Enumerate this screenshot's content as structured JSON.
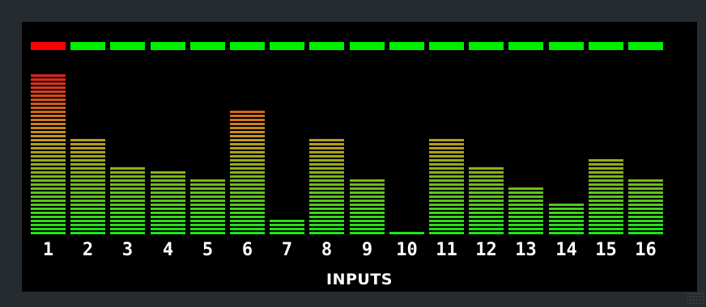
{
  "meter": {
    "title": "INPUTS",
    "max_level": 1.0,
    "channels": [
      {
        "label": "1",
        "level": 1.0,
        "clip": true
      },
      {
        "label": "2",
        "level": 0.61,
        "clip": false
      },
      {
        "label": "3",
        "level": 0.42,
        "clip": false
      },
      {
        "label": "4",
        "level": 0.39,
        "clip": false
      },
      {
        "label": "5",
        "level": 0.36,
        "clip": false
      },
      {
        "label": "6",
        "level": 0.78,
        "clip": false
      },
      {
        "label": "7",
        "level": 0.09,
        "clip": false
      },
      {
        "label": "8",
        "level": 0.61,
        "clip": false
      },
      {
        "label": "9",
        "level": 0.36,
        "clip": false
      },
      {
        "label": "10",
        "level": 0.03,
        "clip": false
      },
      {
        "label": "11",
        "level": 0.61,
        "clip": false
      },
      {
        "label": "12",
        "level": 0.42,
        "clip": false
      },
      {
        "label": "13",
        "level": 0.31,
        "clip": false
      },
      {
        "label": "14",
        "level": 0.19,
        "clip": false
      },
      {
        "label": "15",
        "level": 0.48,
        "clip": false
      },
      {
        "label": "16",
        "level": 0.36,
        "clip": false
      }
    ]
  },
  "colors": {
    "clip_on": "#ff0000",
    "clip_off": "#00ee00",
    "level_low": "#19e61a",
    "level_high": "#e0191f",
    "background": "#000000",
    "frame": "#262b2f"
  }
}
